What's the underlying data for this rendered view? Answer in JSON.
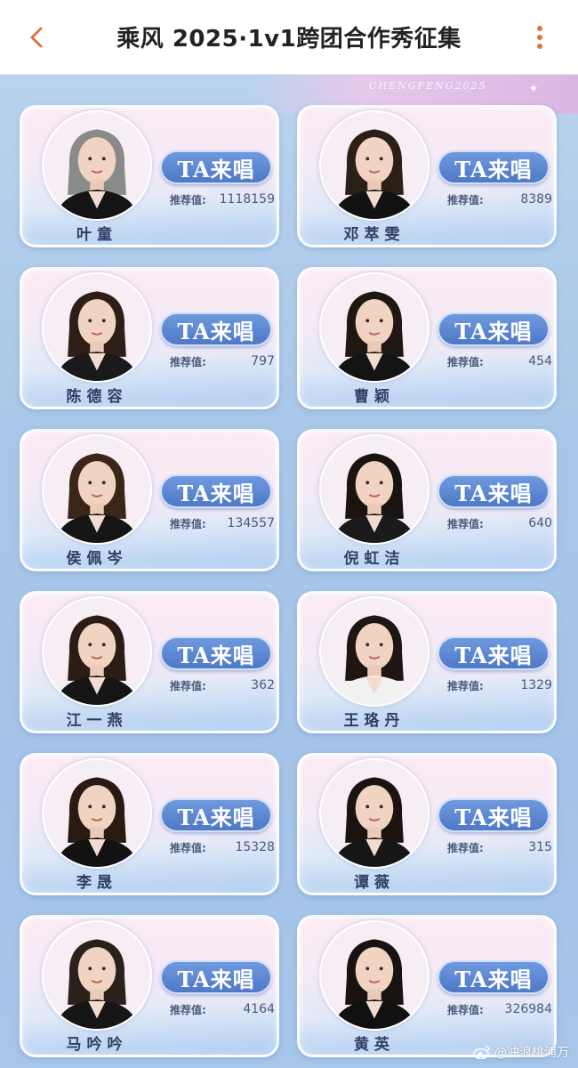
{
  "header": {
    "title": "乘风 2025·1v1跨团合作秀征集",
    "back_icon": "chevron-left-icon",
    "more_icon": "more-vertical-icon",
    "accent": "#e0733a"
  },
  "banner": {
    "watermark": "CHENGFENG2025"
  },
  "vote_label": "TA来唱",
  "score_label": "推荐值:",
  "cards": [
    {
      "name": "叶童",
      "score": "1118159"
    },
    {
      "name": "邓萃雯",
      "score": "8389"
    },
    {
      "name": "陈德容",
      "score": "797"
    },
    {
      "name": "曹颖",
      "score": "454"
    },
    {
      "name": "侯佩岑",
      "score": "134557"
    },
    {
      "name": "倪虹洁",
      "score": "640"
    },
    {
      "name": "江一燕",
      "score": "362"
    },
    {
      "name": "王珞丹",
      "score": "1329"
    },
    {
      "name": "李晟",
      "score": "15328"
    },
    {
      "name": "谭薇",
      "score": "315"
    },
    {
      "name": "马吟吟",
      "score": "4164"
    },
    {
      "name": "黄英",
      "score": "326984"
    }
  ],
  "footer": {
    "source_watermark": "@冲浪桃浦万"
  }
}
